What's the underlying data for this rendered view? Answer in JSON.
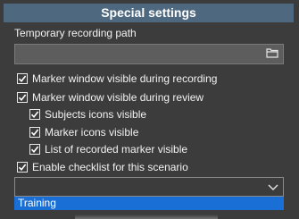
{
  "header": {
    "title": "Special settings"
  },
  "recording_path": {
    "label": "Temporary recording path",
    "value": ""
  },
  "checkboxes": [
    {
      "label": "Marker window visible during recording",
      "checked": true
    },
    {
      "label": "Marker window visible during review",
      "checked": true
    },
    {
      "label": "Subjects icons visible",
      "checked": true
    },
    {
      "label": "Marker icons visible",
      "checked": true
    },
    {
      "label": "List of recorded marker visible",
      "checked": true
    },
    {
      "label": "Enable checklist for this scenario",
      "checked": true
    }
  ],
  "checklist_select": {
    "value": "",
    "options": [
      "Training"
    ]
  },
  "colors": {
    "header_bg": "#4e6880",
    "selected_option_bg": "#1a6fd6"
  }
}
